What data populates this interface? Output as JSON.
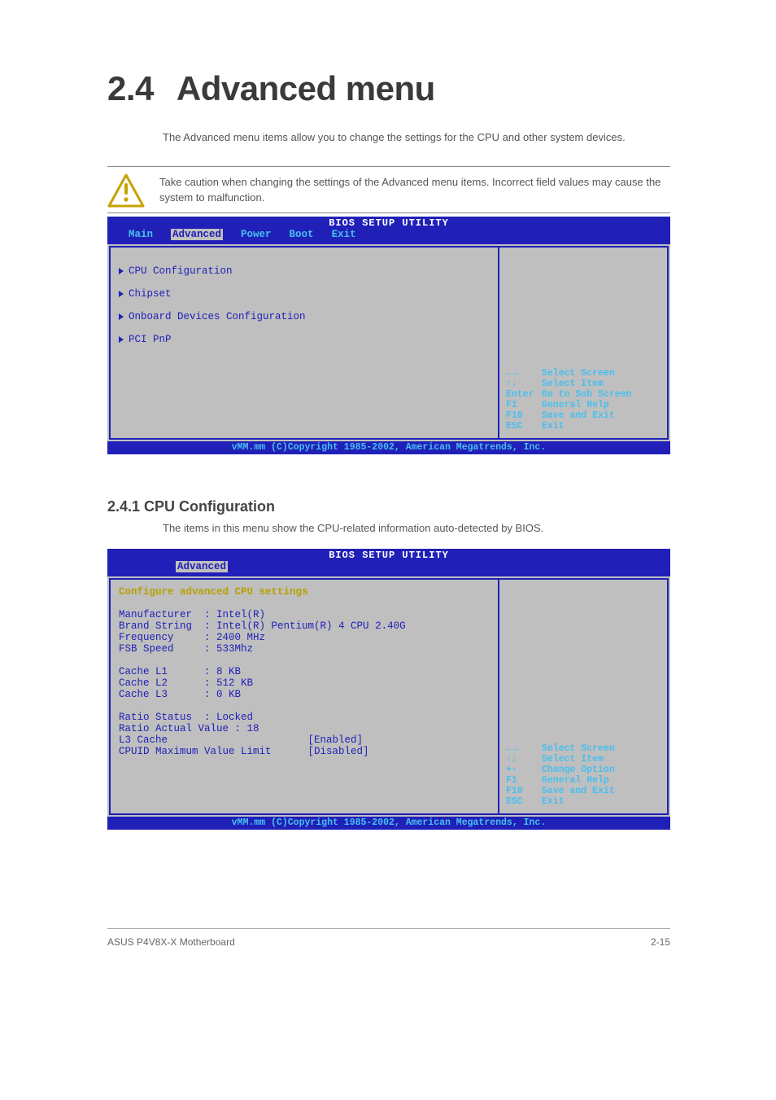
{
  "page": {
    "section_number": "2.4",
    "section_title": "Advanced menu",
    "intro": "The Advanced menu items allow you to change the settings for the CPU and other system devices.",
    "caution": "Take caution when changing the settings of the Advanced menu items. Incorrect field values may cause the system to malfunction.",
    "sub_heading": "2.4.1  CPU Configuration",
    "sub_text": "The items in this menu show the CPU-related information auto-detected by BIOS.",
    "footer_left": "ASUS P4V8X-X Motherboard",
    "footer_right": "2-15"
  },
  "bios1": {
    "utility_title": "BIOS SETUP UTILITY",
    "tabs": [
      "Main",
      "Advanced",
      "Power",
      "Boot",
      "Exit"
    ],
    "active_tab": "Advanced",
    "menu_items": [
      "CPU Configuration",
      "Chipset",
      "Onboard Devices Configuration",
      "PCI PnP"
    ],
    "help": [
      {
        "k": "←→",
        "v": "Select Screen"
      },
      {
        "k": "↑↓",
        "v": "Select Item"
      },
      {
        "k": "Enter",
        "v": "Go to Sub Screen"
      },
      {
        "k": "F1",
        "v": "General Help"
      },
      {
        "k": "F10",
        "v": "Save and Exit"
      },
      {
        "k": "ESC",
        "v": "Exit"
      }
    ],
    "footer": "vMM.mm (C)Copyright 1985-2002, American Megatrends, Inc."
  },
  "bios2": {
    "utility_title": "BIOS SETUP UTILITY",
    "active_tab": "Advanced",
    "header_line": "Configure advanced CPU settings",
    "info": {
      "Manufacturer": "Intel(R)",
      "Brand String": "Intel(R) Pentium(R) 4 CPU 2.40G",
      "Frequency": "2400 MHz",
      "FSB Speed": "533Mhz"
    },
    "cache": {
      "Cache L1": "8 KB",
      "Cache L2": "512 KB",
      "Cache L3": "0 KB"
    },
    "ratio": {
      "Ratio Status": "Locked",
      "Ratio Actual Value": "18"
    },
    "options": [
      {
        "label": "L3 Cache",
        "value": "[Enabled]"
      },
      {
        "label": "CPUID Maximum Value Limit",
        "value": "[Disabled]"
      }
    ],
    "help": [
      {
        "k": "←→",
        "v": "Select Screen"
      },
      {
        "k": "↑↓",
        "v": "Select Item"
      },
      {
        "k": "+-",
        "v": "Change Option"
      },
      {
        "k": "F1",
        "v": "General Help"
      },
      {
        "k": "F10",
        "v": "Save and Exit"
      },
      {
        "k": "ESC",
        "v": "Exit"
      }
    ],
    "footer": "vMM.mm (C)Copyright 1985-2002, American Megatrends, Inc."
  }
}
